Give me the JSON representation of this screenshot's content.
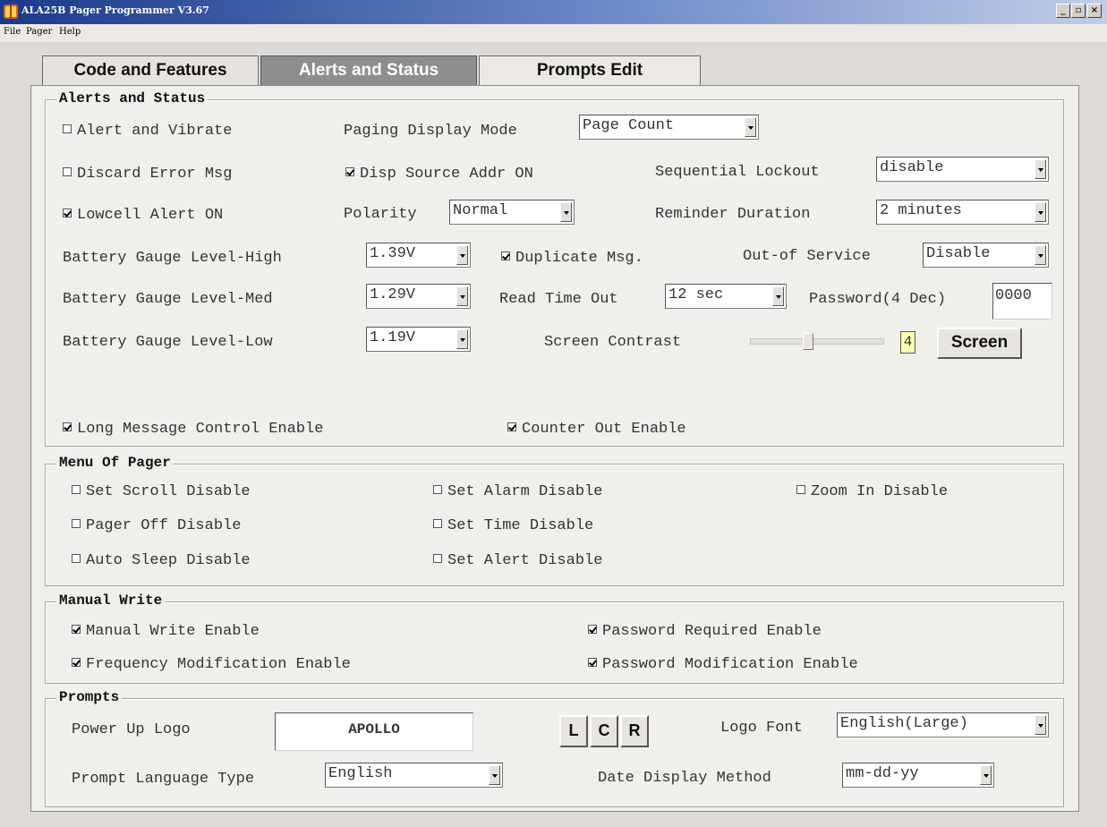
{
  "window": {
    "title": "ALA25B Pager Programmer V3.67",
    "controls": {
      "minimize": "_",
      "maximize": "▫",
      "close": "×"
    }
  },
  "menu": [
    "File",
    "Pager",
    "Help"
  ],
  "tabs": [
    {
      "label": "Code and Features",
      "selected": false
    },
    {
      "label": "Alerts and Status",
      "selected": true
    },
    {
      "label": "Prompts Edit",
      "selected": false
    }
  ],
  "alerts": {
    "group_title": "Alerts and Status",
    "alert_vibrate": {
      "label": "Alert and Vibrate",
      "checked": false
    },
    "paging_display_mode": {
      "label": "Paging Display Mode",
      "value": "Page Count"
    },
    "discard_error": {
      "label": "Discard Error Msg",
      "checked": false
    },
    "disp_source_addr": {
      "label": "Disp Source Addr ON",
      "checked": true
    },
    "sequential_lockout": {
      "label": "Sequential Lockout",
      "value": "disable"
    },
    "lowcell_alert": {
      "label": "Lowcell Alert ON",
      "checked": true
    },
    "polarity": {
      "label": "Polarity",
      "value": "Normal"
    },
    "reminder_duration": {
      "label": "Reminder Duration",
      "value": "2 minutes"
    },
    "battery_high": {
      "label": "Battery Gauge Level-High",
      "value": "1.39V"
    },
    "duplicate_msg": {
      "label": "Duplicate Msg.",
      "checked": true
    },
    "out_of_service": {
      "label": "Out-of Service",
      "value": "Disable"
    },
    "battery_med": {
      "label": "Battery Gauge Level-Med",
      "value": "1.29V"
    },
    "read_time_out": {
      "label": "Read Time Out",
      "value": "12 sec"
    },
    "password": {
      "label": "Password(4 Dec)",
      "value": "0000"
    },
    "battery_low": {
      "label": "Battery Gauge Level-Low",
      "value": "1.19V"
    },
    "screen_contrast": {
      "label": "Screen Contrast",
      "value": "4",
      "level_fraction": 0.4
    },
    "screen_button": "Screen",
    "long_message": {
      "label": "Long Message Control Enable",
      "checked": true
    },
    "counter_out": {
      "label": "Counter Out Enable",
      "checked": true
    }
  },
  "menu_of_pager": {
    "group_title": "Menu Of Pager",
    "items": [
      {
        "label": "Set Scroll Disable",
        "checked": false
      },
      {
        "label": "Set Alarm Disable",
        "checked": false
      },
      {
        "label": "Zoom In Disable",
        "checked": false
      },
      {
        "label": "Pager Off Disable",
        "checked": false
      },
      {
        "label": "Set Time Disable",
        "checked": false
      },
      {
        "label": "Auto Sleep Disable",
        "checked": false
      },
      {
        "label": "Set Alert Disable",
        "checked": false
      }
    ]
  },
  "manual_write": {
    "group_title": "Manual Write",
    "items": [
      {
        "label": "Manual Write Enable",
        "checked": true
      },
      {
        "label": "Password Required Enable",
        "checked": true
      },
      {
        "label": "Frequency Modification Enable",
        "checked": true
      },
      {
        "label": "Password Modification Enable",
        "checked": true
      }
    ]
  },
  "prompts": {
    "group_title": "Prompts",
    "power_up_logo": {
      "label": "Power Up Logo",
      "value": "APOLLO"
    },
    "align_buttons": [
      "L",
      "C",
      "R"
    ],
    "logo_font": {
      "label": "Logo Font",
      "value": "English(Large)"
    },
    "prompt_language": {
      "label": "Prompt Language Type",
      "value": "English"
    },
    "date_display": {
      "label": "Date Display Method",
      "value": "mm-dd-yy"
    }
  }
}
